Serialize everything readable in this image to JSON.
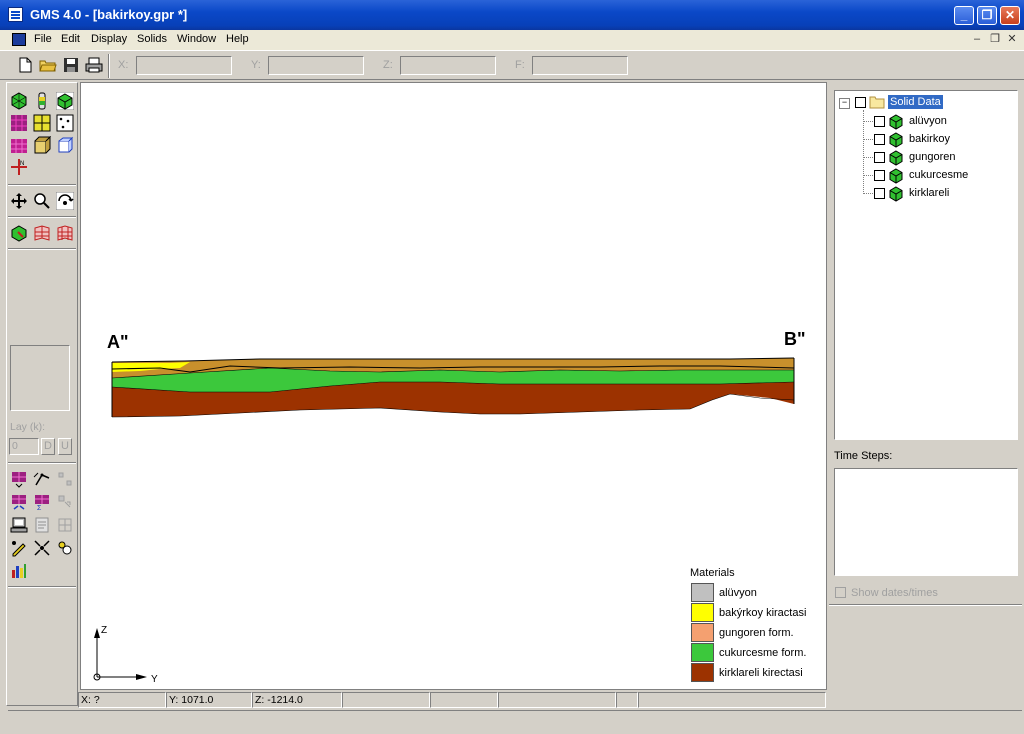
{
  "window": {
    "title": "GMS 4.0 - [bakirkoy.gpr *]",
    "minimize_label": "_",
    "restore_label": "❐",
    "close_label": "✕"
  },
  "menu": {
    "items": [
      "File",
      "Edit",
      "Display",
      "Solids",
      "Window",
      "Help"
    ],
    "mdi_minimize": "–",
    "mdi_restore": "❐",
    "mdi_close": "✕"
  },
  "toolbar": {
    "x_label": "X:",
    "y_label": "Y:",
    "z_label": "Z:",
    "f_label": "F:",
    "x_value": "",
    "y_value": "",
    "z_value": "",
    "f_value": ""
  },
  "left_panel": {
    "layer_label": "Lay (k):",
    "layer_value": "0",
    "down_label": "D",
    "up_label": "U"
  },
  "canvas": {
    "section_start_label": "A\"",
    "section_end_label": "B\"",
    "axis_z_label": "Z",
    "axis_y_label": "Y",
    "legend": {
      "title": "Materials",
      "items": [
        {
          "label": "alüvyon",
          "color": "#c0c0c0"
        },
        {
          "label": "bakýrkoy kiractasi",
          "color": "#ffff00"
        },
        {
          "label": "gungoren form.",
          "color": "#f4a070"
        },
        {
          "label": "cukurcesme form.",
          "color": "#3cc83c"
        },
        {
          "label": "kirklareli kirectasi",
          "color": "#9c3200"
        }
      ]
    }
  },
  "tree": {
    "root_label": "Solid Data",
    "root_expander": "−",
    "items": [
      "alüvyon",
      "bakirkoy",
      "gungoren",
      "cukurcesme",
      "kirklareli"
    ]
  },
  "time_steps": {
    "label": "Time Steps:",
    "show_dates_label": "Show dates/times"
  },
  "status": {
    "x": "X: ?",
    "y": "Y: 1071.0",
    "z": "Z: -1214.0"
  },
  "colors": {
    "titlebar": "#0a48c8",
    "layer_top": "#c8902c",
    "layer_green": "#3cc83c",
    "layer_brown": "#9c3200",
    "layer_yellow": "#ffff00"
  }
}
